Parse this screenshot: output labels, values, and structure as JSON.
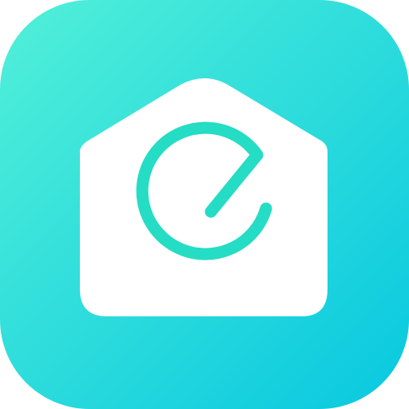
{
  "icon": {
    "semantic_name": "home-with-power-e-logo-icon",
    "gradient": {
      "start": "#52F0D8",
      "end": "#08C8E0"
    },
    "house_color": "#FFFFFF",
    "symbol_color": "#25DCC4"
  }
}
